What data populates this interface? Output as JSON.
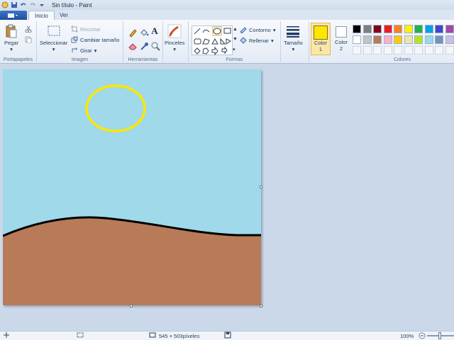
{
  "titlebar": {
    "title": "Sin título - Paint"
  },
  "tabs": [
    {
      "label": "Inicio"
    },
    {
      "label": "Ver"
    }
  ],
  "ribbon": {
    "portapapeles": {
      "label": "Portapapeles",
      "paste": "Pegar"
    },
    "imagen": {
      "label": "Imagen",
      "select": "Seleccionar",
      "crop": "Recortar",
      "resize": "Cambiar tamaño",
      "rotate": "Girar"
    },
    "herramientas": {
      "label": "Herramientas",
      "text_tool": "A"
    },
    "pinceles": {
      "label": "Pinceles"
    },
    "formas": {
      "label": "Formas",
      "outline": "Contorno",
      "fill": "Rellenar"
    },
    "tamano": {
      "label": "Tamaño"
    },
    "color1": {
      "label": "Color",
      "num": "1",
      "value": "#ffe600"
    },
    "color2": {
      "label": "Color",
      "num": "2",
      "value": "#ffffff"
    },
    "colores": {
      "label": "Colores",
      "row1": [
        "#000000",
        "#7f7f7f",
        "#880015",
        "#ed1c24",
        "#ff7f27",
        "#fff200",
        "#22b14c",
        "#00a2e8",
        "#3f48cc",
        "#a349a4"
      ],
      "row2": [
        "#ffffff",
        "#c3c3c3",
        "#b97a57",
        "#ffaec9",
        "#ffc90e",
        "#efe4b0",
        "#b5e61d",
        "#99d9ea",
        "#7092be",
        "#c8bfe7"
      ]
    }
  },
  "canvas": {
    "sky_color": "#9fd9ea",
    "ground_color": "#b97a57",
    "sun_outline_color": "#ffe600",
    "hill_line_color": "#000000"
  },
  "status": {
    "dimensions": "545 × 503píxeles",
    "zoom": "100%"
  }
}
